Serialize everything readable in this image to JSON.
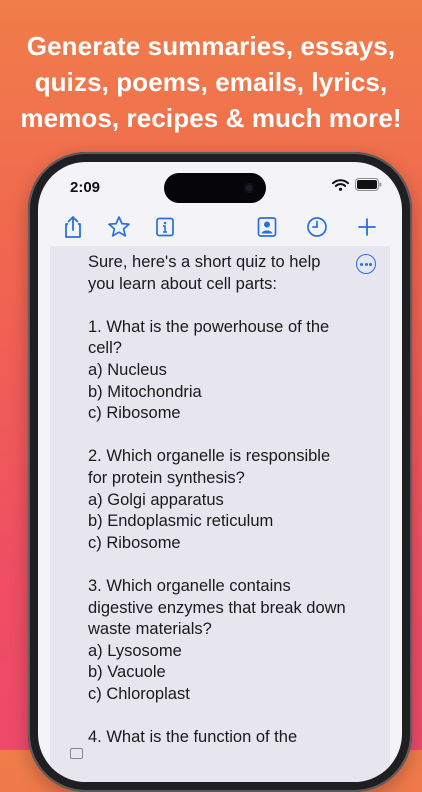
{
  "headline": {
    "line1": "Generate summaries, essays,",
    "line2": "quizs, poems, emails, lyrics,",
    "line3": "memos, recipes & much more!"
  },
  "status_bar": {
    "time": "2:09"
  },
  "toolbar": {
    "icons": [
      "share-icon",
      "star-icon",
      "info-icon",
      "contacts-icon",
      "history-icon",
      "plus-icon"
    ],
    "accent": "#2a6fe0"
  },
  "chat": {
    "message": "Sure, here's a short quiz to help you learn about cell parts:\n\n1. What is the powerhouse of the cell?\na) Nucleus\nb) Mitochondria\nc) Ribosome\n\n2. Which organelle is responsible for protein synthesis?\na) Golgi apparatus\nb) Endoplasmic reticulum\nc) Ribosome\n\n3. Which organelle contains digestive enzymes that break down waste materials?\na) Lysosome\nb) Vacuole\nc) Chloroplast\n\n4. What is the function of the"
  },
  "colors": {
    "background_top": "#f07d4a",
    "background_bottom": "#ee4a6a",
    "panel": "#e7e6ef"
  }
}
